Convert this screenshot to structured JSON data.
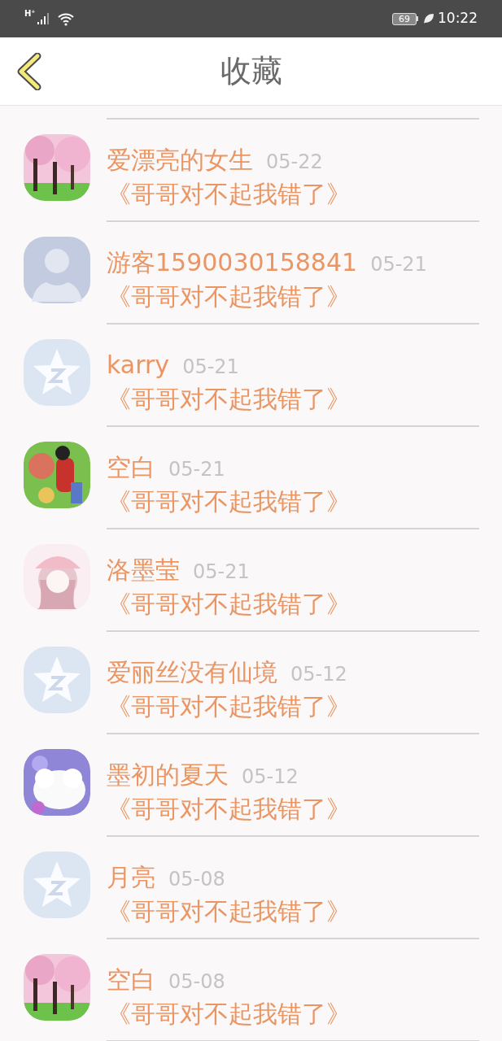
{
  "status_bar": {
    "network": "H⁺",
    "battery": "69",
    "time": "10:22"
  },
  "header": {
    "title": "收藏"
  },
  "items": [
    {
      "name": "爱漂亮的女生",
      "date": "05-22",
      "title": "《哥哥对不起我错了》"
    },
    {
      "name": "游客1590030158841",
      "date": "05-21",
      "title": "《哥哥对不起我错了》",
      "avatar": {
        "kind": "silhouette"
      }
    },
    {
      "name": "karry",
      "date": "05-21",
      "title": "《哥哥对不起我错了》",
      "avatar": {
        "kind": "star"
      }
    },
    {
      "name": "空白",
      "date": "05-21",
      "title": "《哥哥对不起我错了》"
    },
    {
      "name": "洛墨莹",
      "date": "05-21",
      "title": "《哥哥对不起我错了》"
    },
    {
      "name": "爱丽丝没有仙境",
      "date": "05-12",
      "title": "《哥哥对不起我错了》",
      "avatar": {
        "kind": "star"
      }
    },
    {
      "name": "墨初的夏天",
      "date": "05-12",
      "title": "《哥哥对不起我错了》"
    },
    {
      "name": "月亮",
      "date": "05-08",
      "title": "《哥哥对不起我错了》",
      "avatar": {
        "kind": "star"
      }
    },
    {
      "name": "空白",
      "date": "05-08",
      "title": "《哥哥对不起我错了》"
    }
  ]
}
